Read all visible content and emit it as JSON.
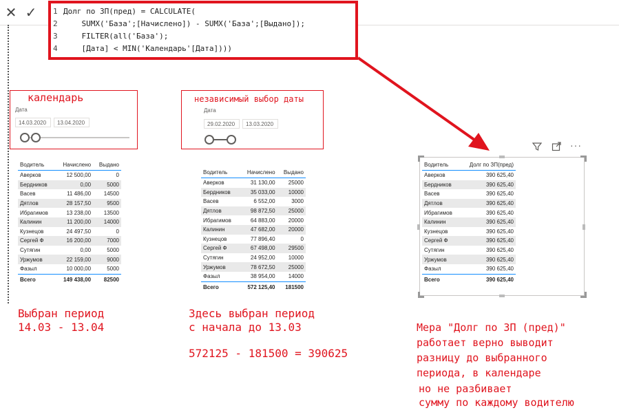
{
  "formula_bar": {
    "cancel_icon": "close-icon",
    "commit_icon": "check-icon",
    "lines": [
      {
        "num": "1",
        "text": "Долг по ЗП(пред) = CALCULATE("
      },
      {
        "num": "2",
        "text": "    SUMX('База';[Начислено]) - SUMX('База';[Выдано]);"
      },
      {
        "num": "3",
        "text": "    FILTER(all('База');"
      },
      {
        "num": "4",
        "text": "    [Дата] < MIN('Календарь'[Дата])))"
      }
    ]
  },
  "slicer1": {
    "caption": "календарь",
    "label": "Дата",
    "date_from": "14.03.2020",
    "date_to": "13.04.2020"
  },
  "slicer2": {
    "caption": "независимый выбор даты",
    "label": "Дата",
    "date_from": "29.02.2020",
    "date_to": "13.03.2020"
  },
  "table1": {
    "headers": [
      "Водитель",
      "Начислено",
      "Выдано"
    ],
    "rows": [
      [
        "Аверков",
        "12 500,00",
        "0"
      ],
      [
        "Бердников",
        "0,00",
        "5000"
      ],
      [
        "Васев",
        "11 486,00",
        "14500"
      ],
      [
        "Дятлов",
        "28 157,50",
        "9500"
      ],
      [
        "Ибрагимов",
        "13 238,00",
        "13500"
      ],
      [
        "Калинин",
        "11 200,00",
        "14000"
      ],
      [
        "Кузнецов",
        "24 497,50",
        "0"
      ],
      [
        "Сергей Ф",
        "16 200,00",
        "7000"
      ],
      [
        "Сутягин",
        "0,00",
        "5000"
      ],
      [
        "Уржумов",
        "22 159,00",
        "9000"
      ],
      [
        "Фазыл",
        "10 000,00",
        "5000"
      ]
    ],
    "total": [
      "Всего",
      "149 438,00",
      "82500"
    ]
  },
  "table2": {
    "headers": [
      "Водитель",
      "Начислено",
      "Выдано"
    ],
    "rows": [
      [
        "Аверков",
        "31 130,00",
        "25000"
      ],
      [
        "Бердников",
        "35 033,00",
        "10000"
      ],
      [
        "Васев",
        "6 552,00",
        "3000"
      ],
      [
        "Дятлов",
        "98 872,50",
        "25000"
      ],
      [
        "Ибрагимов",
        "64 883,00",
        "20000"
      ],
      [
        "Калинин",
        "47 682,00",
        "20000"
      ],
      [
        "Кузнецов",
        "77 896,40",
        "0"
      ],
      [
        "Сергей Ф",
        "67 498,00",
        "29500"
      ],
      [
        "Сутягин",
        "24 952,00",
        "10000"
      ],
      [
        "Уржумов",
        "78 672,50",
        "25000"
      ],
      [
        "Фазыл",
        "38 954,00",
        "14000"
      ]
    ],
    "total": [
      "Всего",
      "572 125,40",
      "181500"
    ]
  },
  "table3": {
    "headers": [
      "Водитель",
      "Долг по ЗП(пред)"
    ],
    "rows": [
      [
        "Аверков",
        "390 625,40"
      ],
      [
        "Бердников",
        "390 625,40"
      ],
      [
        "Васев",
        "390 625,40"
      ],
      [
        "Дятлов",
        "390 625,40"
      ],
      [
        "Ибрагимов",
        "390 625,40"
      ],
      [
        "Калинин",
        "390 625,40"
      ],
      [
        "Кузнецов",
        "390 625,40"
      ],
      [
        "Сергей Ф",
        "390 625,40"
      ],
      [
        "Сутягин",
        "390 625,40"
      ],
      [
        "Уржумов",
        "390 625,40"
      ],
      [
        "Фазыл",
        "390 625,40"
      ]
    ],
    "total": [
      "Всего",
      "390 625,40"
    ]
  },
  "visual_header": {
    "filter_icon": "filter-icon",
    "focus_icon": "focus-mode-icon",
    "more_icon": "more-options-icon"
  },
  "notes": {
    "n1_l1": "Выбран период",
    "n1_l2": "14.03 - 13.04",
    "n2_l1": "Здесь выбран период",
    "n2_l2": "с начала до 13.03",
    "n2_l3": "572125 - 181500 = 390625",
    "n3_l1": "Мера \"Долг по ЗП (пред)\"",
    "n3_l2": "работает верно выводит",
    "n3_l3": "разницу до выбранного",
    "n3_l4": "периода, в календаре",
    "n3_l5": "но не разбивает",
    "n3_l6": "сумму по каждому водителю"
  },
  "colors": {
    "annotation_red": "#e0141e",
    "pbi_blue": "#118dff",
    "keyword_blue": "#3b6fd1"
  }
}
